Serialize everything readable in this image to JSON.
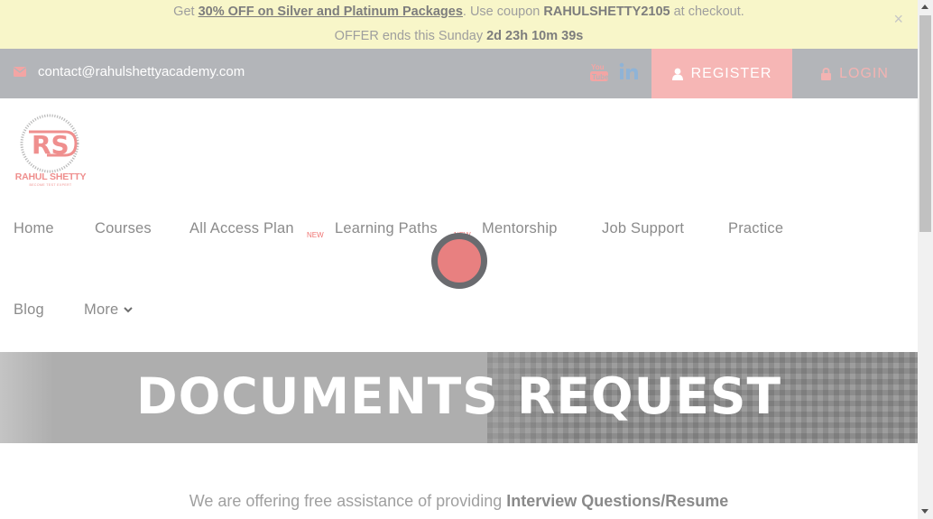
{
  "promo": {
    "prefix": "Get ",
    "offer": "30% OFF on Silver and Platinum Packages",
    "middle": ". Use coupon ",
    "coupon": "RAHULSHETTY2105",
    "suffix": " at checkout.",
    "ends_label": "OFFER ends this Sunday ",
    "countdown": "2d 23h 10m 39s",
    "close_symbol": "×"
  },
  "topbar": {
    "email": "contact@rahulshettyacademy.com",
    "register_label": "REGISTER",
    "login_label": "LOGIN",
    "background": "#b3b5b9",
    "register_bg": "#f6b6b5"
  },
  "logo": {
    "monogram": "RS",
    "brand": "RAHUL SHETTY",
    "tagline": "BECOME TEST EXPERT"
  },
  "nav": {
    "items": [
      {
        "label": "Home"
      },
      {
        "label": "Courses"
      },
      {
        "label": "All Access Plan",
        "badge": "NEW"
      },
      {
        "label": "Learning Paths",
        "badge": "NEW"
      },
      {
        "label": "Mentorship"
      },
      {
        "label": "Job Support"
      },
      {
        "label": "Practice"
      },
      {
        "label": "Blog"
      },
      {
        "label": "More"
      }
    ]
  },
  "hero": {
    "title": "DOCUMENTS REQUEST"
  },
  "intro": {
    "text": "We are offering free assistance of providing ",
    "bold": "Interview Questions/Resume"
  },
  "icons": [
    "envelope-icon",
    "youtube-icon",
    "linkedin-icon",
    "user-icon",
    "lock-icon",
    "chevron-down-icon",
    "close-icon"
  ]
}
